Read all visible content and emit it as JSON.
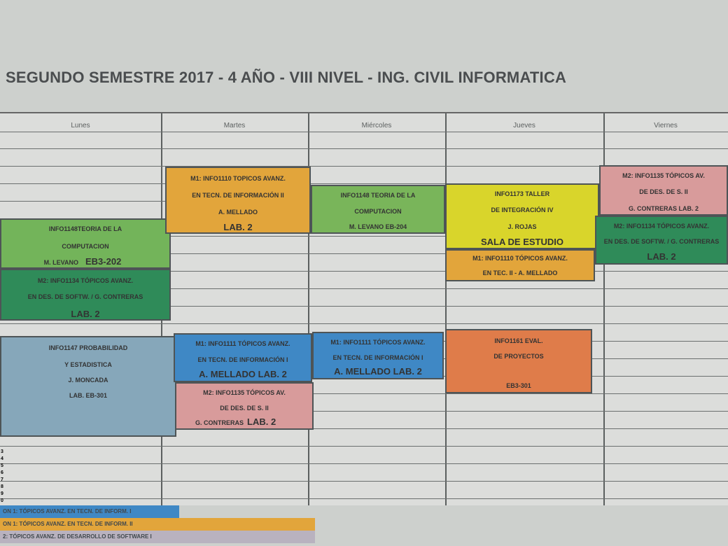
{
  "header": {
    "title": "SEGUNDO  SEMESTRE  2017 - 4 AÑO - VIII NIVEL - ING. CIVIL INFORMATICA"
  },
  "days": [
    "Lunes",
    "Martes",
    "Miércoles",
    "Jueves",
    "Viernes"
  ],
  "blocks": {
    "lunes_teoria": {
      "lines": [
        "INFO1148TEORIA DE LA",
        "COMPUTACION",
        "M. LEVANO",
        "EB3-202"
      ],
      "color": "#73b45a"
    },
    "lunes_topicos": {
      "lines": [
        "M2: INFO1134 TÓPICOS  AVANZ.",
        "EN DES. DE SOFTW. / G. CONTRERAS",
        "LAB. 2"
      ],
      "color": "#2f8b59"
    },
    "lunes_probabilidad": {
      "lines": [
        "INFO1147 PROBABILIDAD",
        "Y ESTADISTICA",
        "J. MONCADA",
        "LAB. EB-301"
      ],
      "color": "#86a7ba"
    },
    "martes_m1": {
      "lines": [
        "M1: INFO1110 TOPICOS AVANZ.",
        "EN TECN. DE INFORMACIÓN II",
        "A. MELLADO",
        "LAB. 2"
      ],
      "color": "#e2a53b"
    },
    "martes_info1111": {
      "lines": [
        "M1: INFO1111 TÓPICOS AVANZ.",
        "EN TECN. DE INFORMACIÓN I",
        "A. MELLADO LAB. 2"
      ],
      "color": "#3f88c5"
    },
    "martes_m2": {
      "lines": [
        "M2: INFO1135 TÓPICOS AV.",
        "DE DES. DE S. II",
        "G. CONTRERAS",
        "LAB. 2"
      ],
      "color": "#d89b9b"
    },
    "miercoles_teoria": {
      "lines": [
        "INFO1148 TEORIA DE LA",
        "COMPUTACION",
        "M. LEVANO  EB-204"
      ],
      "color": "#79b55a"
    },
    "miercoles_info1111": {
      "lines": [
        "M1: INFO1111 TÓPICOS AVANZ.",
        "EN TECN. DE INFORMACIÓN I",
        "A. MELLADO LAB. 2"
      ],
      "color": "#3f88c5"
    },
    "jueves_taller": {
      "lines": [
        "INFO1173 TALLER",
        "DE INTEGRACIÓN IV",
        "J. ROJAS",
        "SALA DE ESTUDIO"
      ],
      "color": "#d9d52b"
    },
    "jueves_m1": {
      "lines": [
        "M1: INFO1110 TÓPICOS AVANZ.",
        "EN TEC. II - A. MELLADO"
      ],
      "color": "#e2a53b"
    },
    "jueves_eval": {
      "lines": [
        "INFO1161 EVAL.",
        "DE PROYECTOS",
        "EB3-301"
      ],
      "color": "#df7c4a"
    },
    "viernes_m2": {
      "lines": [
        "M2: INFO1135 TÓPICOS AV.",
        "DE DES. DE S. II",
        "G. CONTRERAS LAB. 2"
      ],
      "color": "#d89b9b"
    },
    "viernes_topicos": {
      "lines": [
        "M2: INFO1134 TÓPICOS  AVANZ.",
        "EN DES. DE SOFTW. / G. CONTRERAS",
        "LAB. 2"
      ],
      "color": "#2f8b59"
    }
  },
  "legend": [
    {
      "text": "ON 1: TÓPICOS AVANZ. EN TECN. DE INFORM. I",
      "color": "#3f88c5"
    },
    {
      "text": "ON 1: TÓPICOS AVANZ. EN TECN. DE INFORM. II",
      "color": "#e2a53b"
    },
    {
      "text": "2: TÓPICOS AVANZ. DE DESARROLLO DE SOFTWARE I",
      "color": "#b9b2bf"
    }
  ],
  "row_numbers": [
    "3",
    "4",
    "5",
    "6",
    "7",
    "8",
    "9",
    "0"
  ]
}
